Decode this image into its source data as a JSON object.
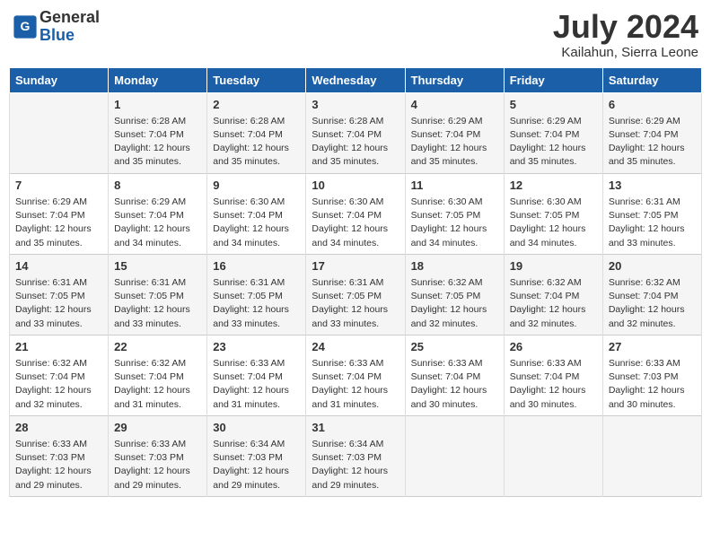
{
  "header": {
    "logo_general": "General",
    "logo_blue": "Blue",
    "month_year": "July 2024",
    "location": "Kailahun, Sierra Leone"
  },
  "days_of_week": [
    "Sunday",
    "Monday",
    "Tuesday",
    "Wednesday",
    "Thursday",
    "Friday",
    "Saturday"
  ],
  "weeks": [
    [
      {
        "day": "",
        "info": ""
      },
      {
        "day": "1",
        "info": "Sunrise: 6:28 AM\nSunset: 7:04 PM\nDaylight: 12 hours\nand 35 minutes."
      },
      {
        "day": "2",
        "info": "Sunrise: 6:28 AM\nSunset: 7:04 PM\nDaylight: 12 hours\nand 35 minutes."
      },
      {
        "day": "3",
        "info": "Sunrise: 6:28 AM\nSunset: 7:04 PM\nDaylight: 12 hours\nand 35 minutes."
      },
      {
        "day": "4",
        "info": "Sunrise: 6:29 AM\nSunset: 7:04 PM\nDaylight: 12 hours\nand 35 minutes."
      },
      {
        "day": "5",
        "info": "Sunrise: 6:29 AM\nSunset: 7:04 PM\nDaylight: 12 hours\nand 35 minutes."
      },
      {
        "day": "6",
        "info": "Sunrise: 6:29 AM\nSunset: 7:04 PM\nDaylight: 12 hours\nand 35 minutes."
      }
    ],
    [
      {
        "day": "7",
        "info": "Sunrise: 6:29 AM\nSunset: 7:04 PM\nDaylight: 12 hours\nand 35 minutes."
      },
      {
        "day": "8",
        "info": "Sunrise: 6:29 AM\nSunset: 7:04 PM\nDaylight: 12 hours\nand 34 minutes."
      },
      {
        "day": "9",
        "info": "Sunrise: 6:30 AM\nSunset: 7:04 PM\nDaylight: 12 hours\nand 34 minutes."
      },
      {
        "day": "10",
        "info": "Sunrise: 6:30 AM\nSunset: 7:04 PM\nDaylight: 12 hours\nand 34 minutes."
      },
      {
        "day": "11",
        "info": "Sunrise: 6:30 AM\nSunset: 7:05 PM\nDaylight: 12 hours\nand 34 minutes."
      },
      {
        "day": "12",
        "info": "Sunrise: 6:30 AM\nSunset: 7:05 PM\nDaylight: 12 hours\nand 34 minutes."
      },
      {
        "day": "13",
        "info": "Sunrise: 6:31 AM\nSunset: 7:05 PM\nDaylight: 12 hours\nand 33 minutes."
      }
    ],
    [
      {
        "day": "14",
        "info": "Sunrise: 6:31 AM\nSunset: 7:05 PM\nDaylight: 12 hours\nand 33 minutes."
      },
      {
        "day": "15",
        "info": "Sunrise: 6:31 AM\nSunset: 7:05 PM\nDaylight: 12 hours\nand 33 minutes."
      },
      {
        "day": "16",
        "info": "Sunrise: 6:31 AM\nSunset: 7:05 PM\nDaylight: 12 hours\nand 33 minutes."
      },
      {
        "day": "17",
        "info": "Sunrise: 6:31 AM\nSunset: 7:05 PM\nDaylight: 12 hours\nand 33 minutes."
      },
      {
        "day": "18",
        "info": "Sunrise: 6:32 AM\nSunset: 7:05 PM\nDaylight: 12 hours\nand 32 minutes."
      },
      {
        "day": "19",
        "info": "Sunrise: 6:32 AM\nSunset: 7:04 PM\nDaylight: 12 hours\nand 32 minutes."
      },
      {
        "day": "20",
        "info": "Sunrise: 6:32 AM\nSunset: 7:04 PM\nDaylight: 12 hours\nand 32 minutes."
      }
    ],
    [
      {
        "day": "21",
        "info": "Sunrise: 6:32 AM\nSunset: 7:04 PM\nDaylight: 12 hours\nand 32 minutes."
      },
      {
        "day": "22",
        "info": "Sunrise: 6:32 AM\nSunset: 7:04 PM\nDaylight: 12 hours\nand 31 minutes."
      },
      {
        "day": "23",
        "info": "Sunrise: 6:33 AM\nSunset: 7:04 PM\nDaylight: 12 hours\nand 31 minutes."
      },
      {
        "day": "24",
        "info": "Sunrise: 6:33 AM\nSunset: 7:04 PM\nDaylight: 12 hours\nand 31 minutes."
      },
      {
        "day": "25",
        "info": "Sunrise: 6:33 AM\nSunset: 7:04 PM\nDaylight: 12 hours\nand 30 minutes."
      },
      {
        "day": "26",
        "info": "Sunrise: 6:33 AM\nSunset: 7:04 PM\nDaylight: 12 hours\nand 30 minutes."
      },
      {
        "day": "27",
        "info": "Sunrise: 6:33 AM\nSunset: 7:03 PM\nDaylight: 12 hours\nand 30 minutes."
      }
    ],
    [
      {
        "day": "28",
        "info": "Sunrise: 6:33 AM\nSunset: 7:03 PM\nDaylight: 12 hours\nand 29 minutes."
      },
      {
        "day": "29",
        "info": "Sunrise: 6:33 AM\nSunset: 7:03 PM\nDaylight: 12 hours\nand 29 minutes."
      },
      {
        "day": "30",
        "info": "Sunrise: 6:34 AM\nSunset: 7:03 PM\nDaylight: 12 hours\nand 29 minutes."
      },
      {
        "day": "31",
        "info": "Sunrise: 6:34 AM\nSunset: 7:03 PM\nDaylight: 12 hours\nand 29 minutes."
      },
      {
        "day": "",
        "info": ""
      },
      {
        "day": "",
        "info": ""
      },
      {
        "day": "",
        "info": ""
      }
    ]
  ]
}
